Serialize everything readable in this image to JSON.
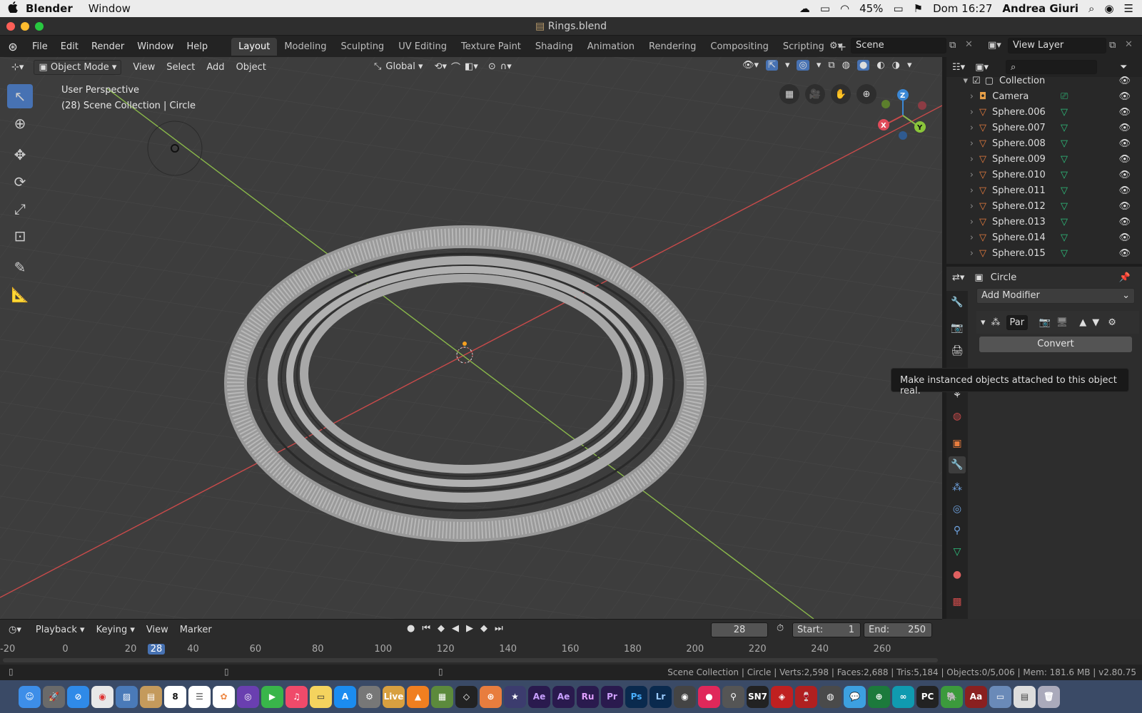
{
  "macbar": {
    "apple": "",
    "app_name": "Blender",
    "menu": [
      "Window"
    ],
    "battery": "45%",
    "clock": "Dom 16:27",
    "user": "Andrea Giuri"
  },
  "window": {
    "title": "Rings.blend"
  },
  "topbar": {
    "menus": [
      "File",
      "Edit",
      "Render",
      "Window",
      "Help"
    ],
    "workspaces": [
      "Layout",
      "Modeling",
      "Sculpting",
      "UV Editing",
      "Texture Paint",
      "Shading",
      "Animation",
      "Rendering",
      "Compositing",
      "Scripting"
    ],
    "active_workspace": "Layout",
    "add_tab": "+",
    "scene": "Scene",
    "view_layer": "View Layer"
  },
  "viewport": {
    "mode": "Object Mode",
    "menus": [
      "View",
      "Select",
      "Add",
      "Object"
    ],
    "orientation": "Global",
    "overlay_line1": "User Perspective",
    "overlay_line2": "(28) Scene Collection | Circle",
    "gizmo": {
      "x": "X",
      "y": "Y",
      "z": "Z"
    }
  },
  "outliner": {
    "collection": "Collection",
    "items": [
      "Camera",
      "Sphere.006",
      "Sphere.007",
      "Sphere.008",
      "Sphere.009",
      "Sphere.010",
      "Sphere.011",
      "Sphere.012",
      "Sphere.013",
      "Sphere.014",
      "Sphere.015"
    ]
  },
  "properties": {
    "object_name": "Circle",
    "add_modifier": "Add Modifier",
    "modifier_name": "Par",
    "convert_button": "Convert",
    "tooltip": "Make instanced objects attached to this object real."
  },
  "timeline": {
    "menus": [
      "Playback",
      "Keying",
      "View",
      "Marker"
    ],
    "current_frame": "28",
    "start_label": "Start:",
    "start_value": "1",
    "end_label": "End:",
    "end_value": "250",
    "ticks": [
      "-20",
      "0",
      "20",
      "28",
      "40",
      "60",
      "80",
      "100",
      "120",
      "140",
      "160",
      "180",
      "200",
      "220",
      "240",
      "260"
    ]
  },
  "status": {
    "text": "Scene Collection | Circle | Verts:2,598 | Faces:2,688 | Tris:5,184 | Objects:0/5,006 | Mem: 181.6 MB | v2.80.75"
  },
  "colors": {
    "accent": "#4772b3",
    "x_axis": "#c84a4a",
    "y_axis": "#8ab84a",
    "z_axis": "#3b88d6",
    "mesh_icon": "#2ec27e",
    "object_icon": "#e87d3e"
  },
  "dock": {
    "icons": [
      "finder-icon",
      "launchpad-icon",
      "safari-icon",
      "chrome-icon",
      "preview-icon",
      "notes-icon",
      "calendar-icon",
      "reminders-icon",
      "photos-icon",
      "siri-icon",
      "facetime-icon",
      "music-icon",
      "stickies-icon",
      "appstore-icon",
      "preferences-icon",
      "blender-icon"
    ],
    "labels": [
      "Live",
      "Ae",
      "Ae",
      "Ru",
      "Pr",
      "Ps",
      "Lr",
      "SN7",
      "PC",
      "Aa"
    ],
    "calendar_day": "8"
  }
}
